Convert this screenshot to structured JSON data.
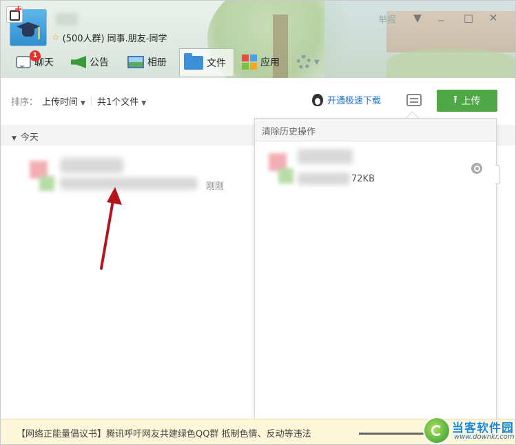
{
  "header": {
    "group_size": "(500人群)",
    "group_tags": "同事.朋友-同学",
    "report": "举报"
  },
  "window_controls": {
    "dropdown": "▼",
    "minimize": "_",
    "maximize": "□",
    "close": "✕"
  },
  "tabs": [
    {
      "label": "聊天",
      "badge": "1"
    },
    {
      "label": "公告"
    },
    {
      "label": "相册"
    },
    {
      "label": "文件"
    },
    {
      "label": "应用"
    }
  ],
  "toolbar": {
    "sort_label": "排序：",
    "sort_value": "上传时间",
    "file_count": "共1个文件",
    "speed_download": "开通极速下载",
    "upload": "上传"
  },
  "section": {
    "today": "今天"
  },
  "file": {
    "time": "刚刚"
  },
  "history_panel": {
    "title": "清除历史操作",
    "size": "72KB"
  },
  "notice": {
    "text": "【网络正能量倡议书】腾讯呼吁网友共建绿色QQ群 抵制色情、反动等违法"
  },
  "watermark": {
    "title": "当客软件园",
    "url": "www.downkr.com"
  },
  "colors": {
    "upload_green": "#4fa846",
    "link_blue": "#1a6fc9",
    "badge_red": "#e5322d",
    "arrow_red": "#b4141e"
  },
  "icons": {
    "chat": "chat-bubble-icon",
    "notice": "speaker-icon",
    "album": "photo-icon",
    "files": "folder-icon",
    "apps": "apps-grid-icon",
    "settings": "gear-icon",
    "upload": "upload-arrow-icon",
    "speed": "qq-penguin-icon",
    "transfer": "transfer-tray-icon",
    "search": "magnifier-icon"
  }
}
